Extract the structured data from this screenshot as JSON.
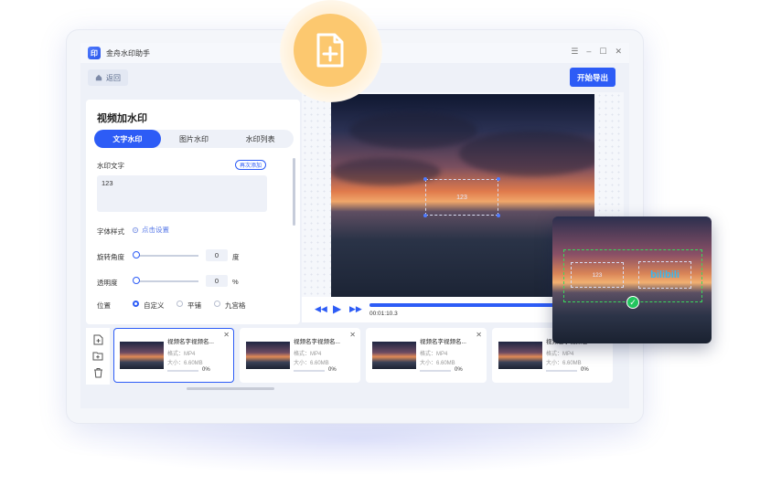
{
  "app": {
    "title": "金舟水印助手",
    "logo_text": "印"
  },
  "window_controls": {
    "menu": "☰",
    "minimize": "–",
    "maximize": "☐",
    "close": "✕"
  },
  "toolbar": {
    "back_label": "返回",
    "export_label": "开始导出"
  },
  "panel": {
    "title": "视频加水印",
    "tabs": [
      {
        "label": "文字水印",
        "active": true
      },
      {
        "label": "图片水印",
        "active": false
      },
      {
        "label": "水印列表",
        "active": false
      }
    ],
    "watermark_text_label": "水印文字",
    "re_add_label": "再次添加",
    "watermark_text_value": "123",
    "font_style_label": "字体样式",
    "font_settings_link": "点击设置",
    "rotation_label": "旋转角度",
    "rotation_value": "0",
    "rotation_unit": "度",
    "opacity_label": "透明度",
    "opacity_value": "0",
    "opacity_unit": "%",
    "position_label": "位置",
    "position_options": [
      {
        "label": "自定义",
        "selected": true
      },
      {
        "label": "平铺",
        "selected": false
      },
      {
        "label": "九宫格",
        "selected": false
      }
    ]
  },
  "preview": {
    "watermark_text": "123",
    "time": "00:01:10.3",
    "progress": 0.93
  },
  "files": [
    {
      "name": "视频名字视频名...",
      "format": "格式：MP4",
      "size": "大小：6.60MB",
      "percent": "0%",
      "selected": true
    },
    {
      "name": "视频名字视频名...",
      "format": "格式：MP4",
      "size": "大小：6.60MB",
      "percent": "0%",
      "selected": false
    },
    {
      "name": "视频名字视频名...",
      "format": "格式：MP4",
      "size": "大小：6.60MB",
      "percent": "0%",
      "selected": false
    },
    {
      "name": "视频名字视频名...",
      "format": "格式：MP4",
      "size": "大小：6.60MB",
      "percent": "0%",
      "selected": false
    }
  ],
  "zoom_card": {
    "text_watermark": "123",
    "image_watermark": "bilibili"
  },
  "icons": {
    "add_file": "add-file-icon",
    "home": "home-icon",
    "gear": "gear-icon",
    "play": "play-icon",
    "rewind": "rewind-icon",
    "forward": "forward-icon",
    "file_add": "file-add-icon",
    "folder_add": "folder-add-icon",
    "trash": "trash-icon",
    "check": "check-icon"
  },
  "colors": {
    "accent": "#2d5cf6",
    "add_circle": "#fcc86f",
    "check": "#22c55e"
  }
}
